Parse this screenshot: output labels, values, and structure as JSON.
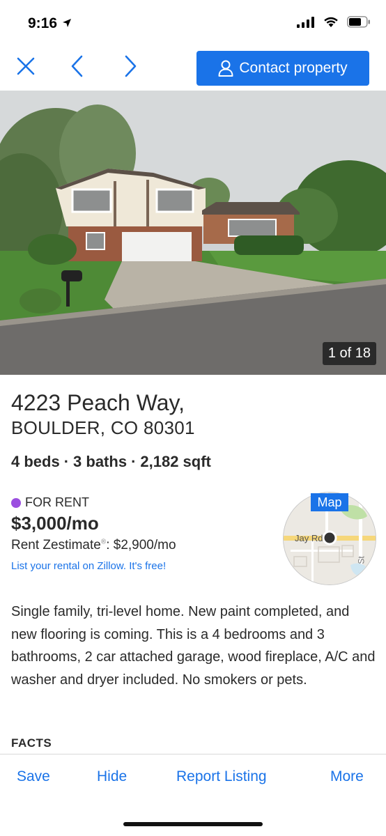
{
  "status_bar": {
    "time": "9:16"
  },
  "nav": {
    "close_icon": "close-icon",
    "back_icon": "chevron-left-icon",
    "forward_icon": "chevron-right-icon",
    "contact_label": "Contact property",
    "accent": "#1a73e8"
  },
  "photo": {
    "counter": "1 of 18"
  },
  "address": {
    "street": "4223 Peach Way,",
    "city_state_zip": "BOULDER, CO 80301"
  },
  "facts": {
    "beds": "4 beds",
    "baths": "3 baths",
    "sqft": "2,182 sqft"
  },
  "listing": {
    "status": "FOR RENT",
    "status_color": "#9b4fe0",
    "price": "$3,000/mo",
    "zestimate_label": "Rent Zestimate",
    "zestimate_mark": "®",
    "zestimate_value": ": $2,900/mo",
    "list_link": "List your rental on Zillow. It's free!"
  },
  "map": {
    "label": "Map",
    "street_label": "Jay Rd",
    "street_label_2": "St"
  },
  "description": "Single family, tri-level home. New paint completed, and new flooring is coming. This is a 4 bedrooms and 3 bathrooms, 2 car attached garage, wood fireplace, A/C and washer and dryer included. No smokers or pets.",
  "facts_header": "FACTS",
  "bottom_bar": {
    "save": "Save",
    "hide": "Hide",
    "report": "Report Listing",
    "more": "More"
  }
}
